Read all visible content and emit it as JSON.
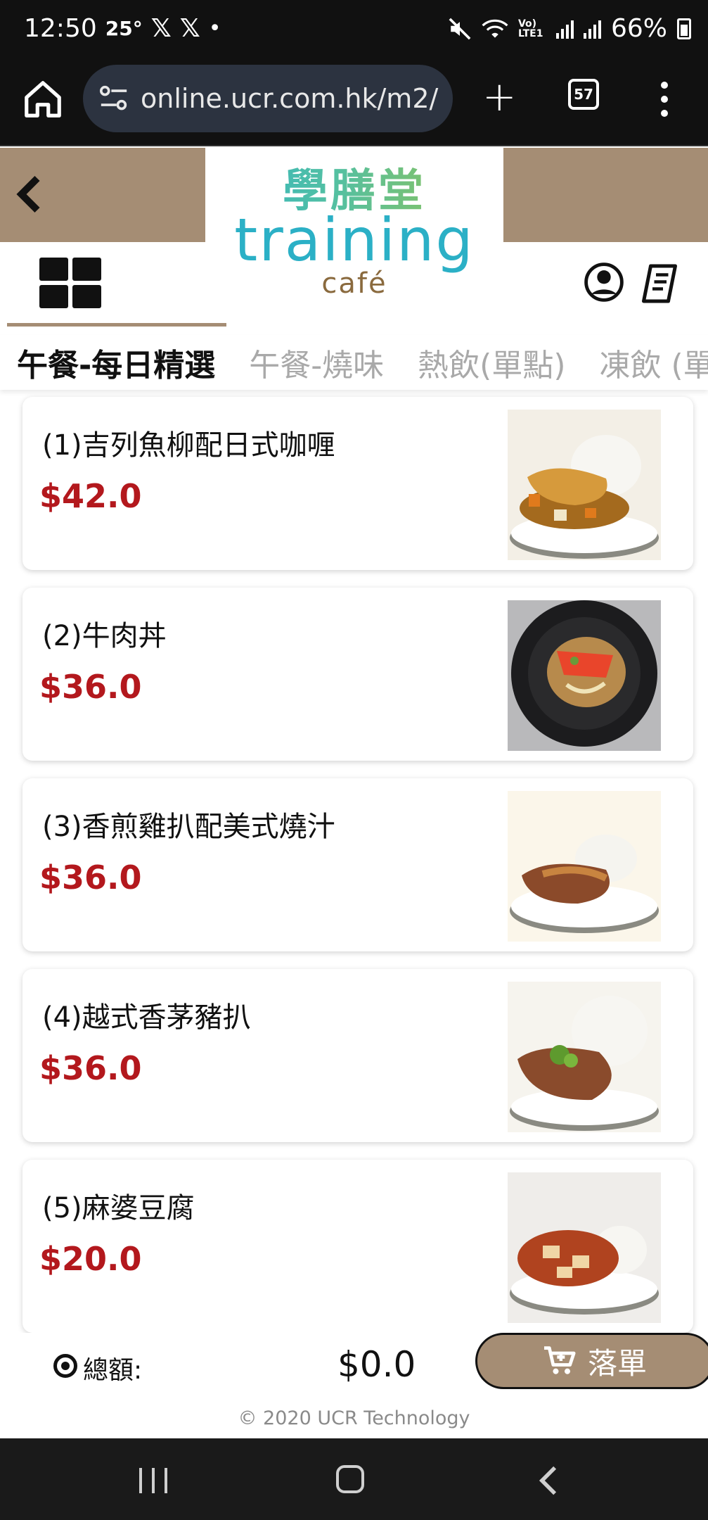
{
  "status_bar": {
    "time": "12:50",
    "temperature": "25°",
    "x_icon_1": "𝕏",
    "x_icon_2": "𝕏",
    "dot": "•",
    "network": "Vo) LTE1",
    "battery": "66%"
  },
  "browser": {
    "url": "online.ucr.com.hk/m2/",
    "tab_count": "57"
  },
  "header": {
    "logo_chinese": "學膳堂",
    "logo_english": "training",
    "logo_sub": "café"
  },
  "categories": [
    {
      "label": "午餐-每日精選",
      "active": true
    },
    {
      "label": "午餐-燒味",
      "active": false
    },
    {
      "label": "熱飲(單點)",
      "active": false
    },
    {
      "label": "凍飲 (單",
      "active": false
    }
  ],
  "items": [
    {
      "name": "(1)吉列魚柳配日式咖喱",
      "price": "$42.0",
      "photo": "fish-fillet-curry"
    },
    {
      "name": "(2)牛肉丼",
      "price": "$36.0",
      "photo": "beef-rice-bowl"
    },
    {
      "name": "(3)香煎雞扒配美式燒汁",
      "price": "$36.0",
      "photo": "chicken-chop"
    },
    {
      "name": "(4)越式香茅豬扒",
      "price": "$36.0",
      "photo": "lemongrass-pork-chop"
    },
    {
      "name": "(5)麻婆豆腐",
      "price": "$20.0",
      "photo": "mapo-tofu"
    }
  ],
  "order_bar": {
    "total_label": "總額:",
    "total_value": "$0.0",
    "order_button": "落單",
    "copyright": "© 2020 UCR Technology"
  },
  "colors": {
    "brand_brown": "#a58d74",
    "price_red": "#b3181d",
    "logo_teal": "#2bb0c6",
    "logo_green": "#9cc34a"
  }
}
